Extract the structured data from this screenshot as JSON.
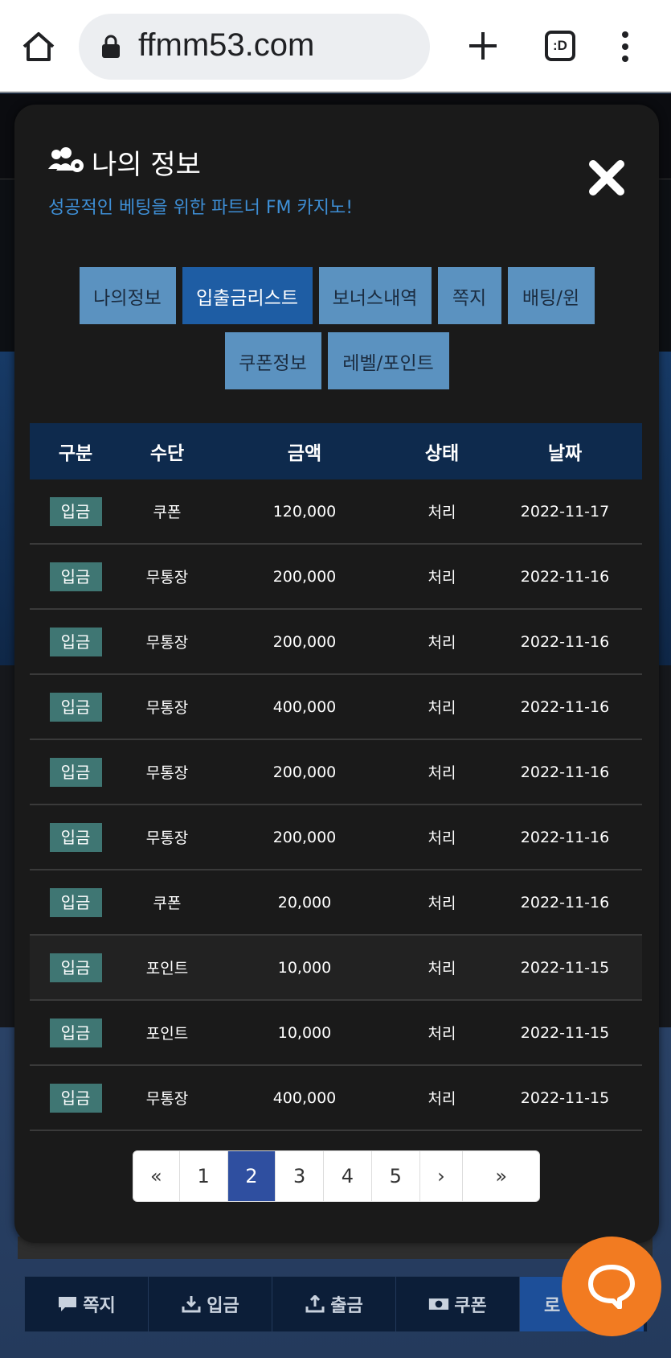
{
  "browser": {
    "url": "ffmm53.com",
    "tab_count_label": ":D",
    "icons": [
      "home-icon",
      "lock-icon",
      "plus-icon",
      "tab-switcher-icon",
      "more-vert-icon"
    ]
  },
  "modal": {
    "title": "나의 정보",
    "subtitle": "성공적인 베팅을 위한 파트너 FM 카지노!",
    "icons": [
      "users-gear-icon",
      "close-icon"
    ],
    "accent_color": "#3e8fd6"
  },
  "tabs": [
    {
      "label": "나의정보",
      "active": false
    },
    {
      "label": "입출금리스트",
      "active": true
    },
    {
      "label": "보너스내역",
      "active": false
    },
    {
      "label": "쪽지",
      "active": false
    },
    {
      "label": "배팅/윈",
      "active": false
    },
    {
      "label": "쿠폰정보",
      "active": false
    },
    {
      "label": "레벨/포인트",
      "active": false
    }
  ],
  "table": {
    "headers": [
      "구분",
      "수단",
      "금액",
      "상태",
      "날짜"
    ],
    "rows": [
      {
        "type": "입금",
        "method": "쿠폰",
        "amount": "120,000",
        "status": "처리",
        "date": "2022-11-17"
      },
      {
        "type": "입금",
        "method": "무통장",
        "amount": "200,000",
        "status": "처리",
        "date": "2022-11-16"
      },
      {
        "type": "입금",
        "method": "무통장",
        "amount": "200,000",
        "status": "처리",
        "date": "2022-11-16"
      },
      {
        "type": "입금",
        "method": "무통장",
        "amount": "400,000",
        "status": "처리",
        "date": "2022-11-16"
      },
      {
        "type": "입금",
        "method": "무통장",
        "amount": "200,000",
        "status": "처리",
        "date": "2022-11-16"
      },
      {
        "type": "입금",
        "method": "무통장",
        "amount": "200,000",
        "status": "처리",
        "date": "2022-11-16"
      },
      {
        "type": "입금",
        "method": "쿠폰",
        "amount": "20,000",
        "status": "처리",
        "date": "2022-11-16"
      },
      {
        "type": "입금",
        "method": "포인트",
        "amount": "10,000",
        "status": "처리",
        "date": "2022-11-15"
      },
      {
        "type": "입금",
        "method": "포인트",
        "amount": "10,000",
        "status": "처리",
        "date": "2022-11-15"
      },
      {
        "type": "입금",
        "method": "무통장",
        "amount": "400,000",
        "status": "처리",
        "date": "2022-11-15"
      }
    ],
    "header_color": "#0e2a4d",
    "badge_color": "#3f7673"
  },
  "pagination": {
    "first": "«",
    "pages": [
      "1",
      "2",
      "3",
      "4",
      "5"
    ],
    "current": "2",
    "next": "›",
    "last": "»"
  },
  "bottom_nav": {
    "items": [
      {
        "label": "쪽지",
        "icon": "message-icon"
      },
      {
        "label": "입금",
        "icon": "download-icon"
      },
      {
        "label": "출금",
        "icon": "upload-icon"
      },
      {
        "label": "쿠폰",
        "icon": "money-icon"
      },
      {
        "label": "로"
      }
    ]
  },
  "chat": {
    "icon": "chat-bubble-icon",
    "color": "#f27b21"
  }
}
